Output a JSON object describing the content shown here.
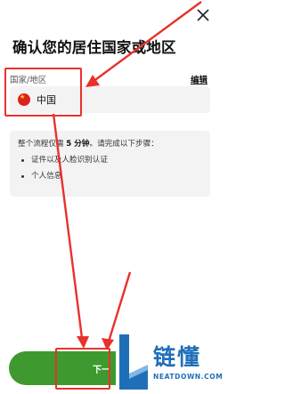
{
  "header": {
    "close_icon": "close-icon",
    "title": "确认您的居住国家或地区"
  },
  "country_field": {
    "label": "国家/地区",
    "edit_label": "编辑",
    "flag_icon": "china-flag-icon",
    "value": "中国"
  },
  "info_card": {
    "text_before": "整个流程仅需 ",
    "text_emphasis": "5 分钟",
    "text_after": "。请完成以下步骤：",
    "items": [
      "证件以及人脸识别认证",
      "个人信息"
    ]
  },
  "footer": {
    "next_label": "下一"
  },
  "watermark": {
    "title": "链懂",
    "subtitle": "NEATDOWN.COM"
  },
  "colors": {
    "accent": "#3e9a2e",
    "annotation": "#e8322c",
    "watermark": "#1f6fb8"
  }
}
